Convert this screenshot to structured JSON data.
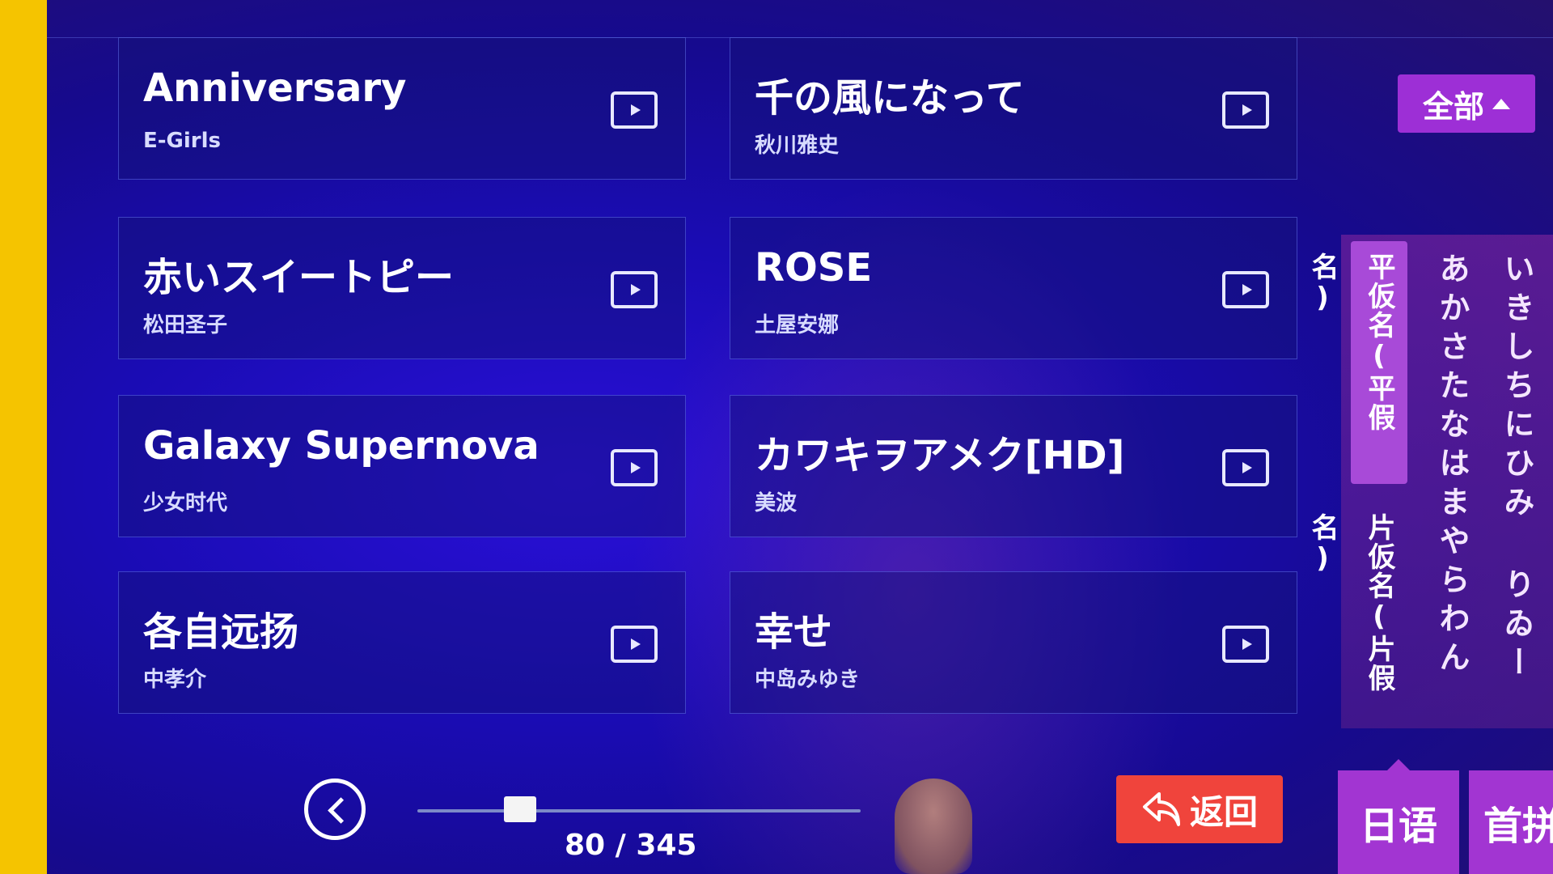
{
  "colors": {
    "screen_bg": "#1a0cb4",
    "filter_button": "#9d2fd6",
    "return_button": "#f0443c",
    "lang_tab": "#a235d2",
    "active_top_tab": "#f5c800",
    "bezel": "#f5c400"
  },
  "songs": [
    {
      "title": "Anniversary",
      "artist": "E-Girls",
      "icon": "play-video-icon"
    },
    {
      "title": "千の風になって",
      "artist": "秋川雅史",
      "icon": "play-video-icon"
    },
    {
      "title": "赤いスイートピー",
      "artist": "松田圣子",
      "icon": "play-video-icon"
    },
    {
      "title": "ROSE",
      "artist": "土屋安娜",
      "icon": "play-video-icon"
    },
    {
      "title": "Galaxy Supernova",
      "artist": "少女时代",
      "icon": "play-video-icon"
    },
    {
      "title": "カワキヲアメク[HD]",
      "artist": "美波",
      "icon": "play-video-icon"
    },
    {
      "title": "各自远扬",
      "artist": "中孝介",
      "icon": "play-video-icon"
    },
    {
      "title": "幸せ",
      "artist": "中岛みゆき",
      "icon": "play-video-icon"
    }
  ],
  "filter": {
    "label": "全部",
    "icon": "caret-up-icon"
  },
  "kana_panel": {
    "tabs": [
      {
        "label": "平仮名(平假名)",
        "active": true
      },
      {
        "label": "片仮名(片假名)",
        "active": false
      }
    ],
    "columns": [
      "あかさたなはまやらわん",
      "いきしちにひみ りゐー"
    ]
  },
  "pagination": {
    "current": 80,
    "total": 345,
    "label": "80 / 345",
    "progress": 0.232
  },
  "return_button": {
    "label": "返回",
    "icon": "return-arrow-icon"
  },
  "lang_tabs": [
    {
      "label": "日语",
      "active": true
    },
    {
      "label": "首拼",
      "active": false
    }
  ]
}
